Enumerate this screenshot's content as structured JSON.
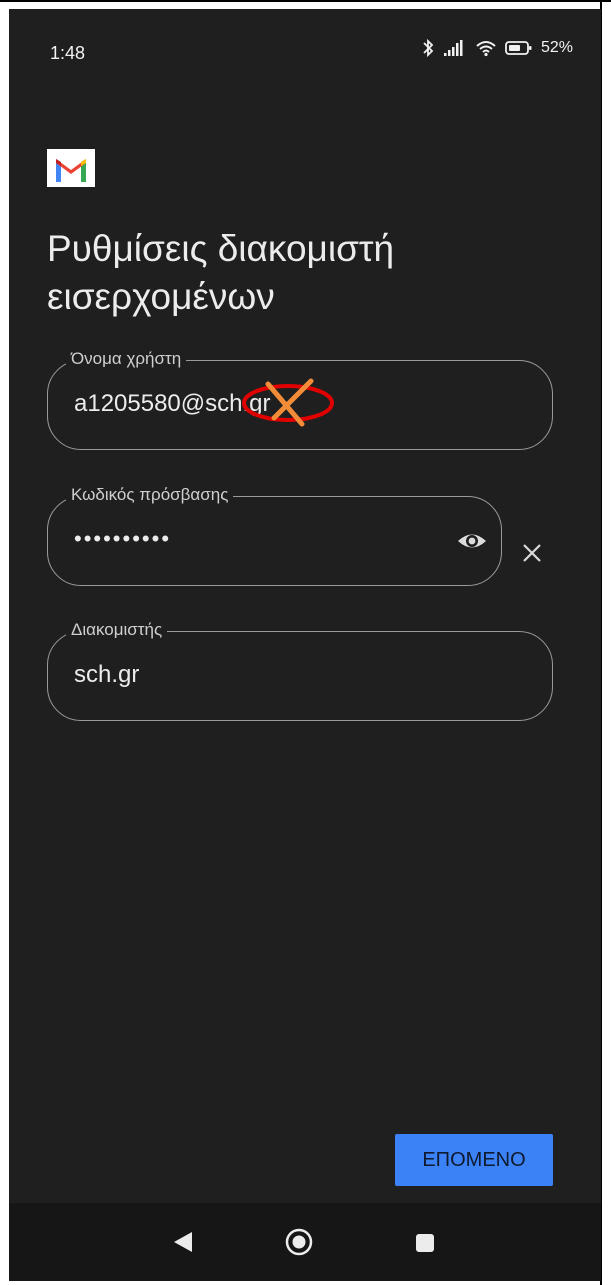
{
  "status_bar": {
    "time": "1:48",
    "battery": "52"
  },
  "screen": {
    "title": "Ρυθμίσεις διακομιστή εισερχομένων"
  },
  "fields": {
    "username": {
      "label": "Όνομα χρήστη",
      "value": "a1205580@sch.gr"
    },
    "password": {
      "label": "Κωδικός πρόσβασης",
      "value": "••••••••••"
    },
    "server": {
      "label": "Διακομιστής",
      "value": "sch.gr"
    }
  },
  "actions": {
    "next_label": "ΕΠΟΜΕΝΟ"
  },
  "icons": {
    "bluetooth": "bluetooth-icon",
    "signal": "signal-icon",
    "wifi": "wifi-icon",
    "battery": "battery-icon",
    "gmail": "gmail-logo-icon",
    "eye": "eye-icon",
    "clear": "close-icon",
    "back": "back-icon",
    "home": "home-icon",
    "recent": "recent-apps-icon"
  },
  "colors": {
    "background": "#1f1f1f",
    "accent": "#3b82f6",
    "annotation_red": "#e10000",
    "annotation_orange": "#f28c38"
  }
}
